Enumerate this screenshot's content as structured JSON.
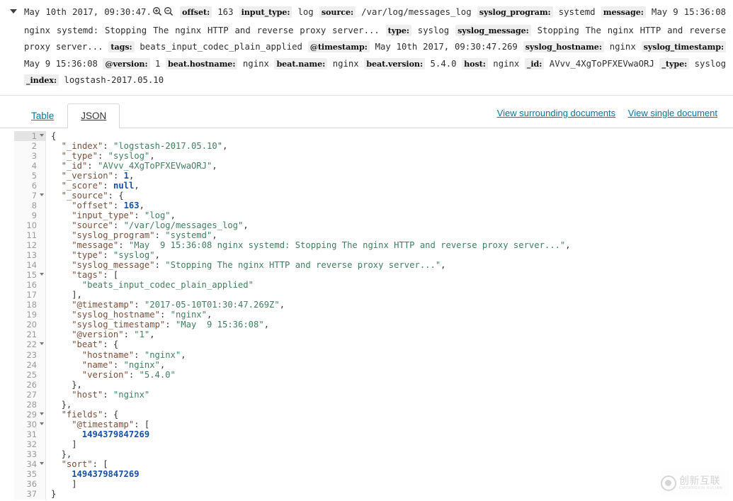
{
  "header": {
    "timestamp": "May 10th 2017, 09:30:47.",
    "zoom_in_icon": "magnify-plus-icon",
    "zoom_out_icon": "magnify-minus-icon",
    "expand_caret_icon": "caret-down-icon",
    "fields": [
      {
        "key": "offset",
        "value": "163"
      },
      {
        "key": "input_type",
        "value": "log"
      },
      {
        "key": "source",
        "value": "/var/log/messages_log"
      },
      {
        "key": "syslog_program",
        "value": "systemd"
      },
      {
        "key": "message",
        "value": "May 9 15:36:08 nginx systemd: Stopping The nginx HTTP and reverse proxy server..."
      },
      {
        "key": "type",
        "value": "syslog"
      },
      {
        "key": "syslog_message",
        "value": "Stopping The nginx HTTP and reverse proxy server..."
      },
      {
        "key": "tags",
        "value": "beats_input_codec_plain_applied"
      },
      {
        "key": "@timestamp",
        "value": "May 10th 2017, 09:30:47.269"
      },
      {
        "key": "syslog_hostname",
        "value": "nginx"
      },
      {
        "key": "syslog_timestamp",
        "value": "May 9 15:36:08"
      },
      {
        "key": "@version",
        "value": "1"
      },
      {
        "key": "beat.hostname",
        "value": "nginx"
      },
      {
        "key": "beat.name",
        "value": "nginx"
      },
      {
        "key": "beat.version",
        "value": "5.4.0"
      },
      {
        "key": "host",
        "value": "nginx"
      },
      {
        "key": "_id",
        "value": "AVvv_4XgToPFXEVwaORJ"
      },
      {
        "key": "_type",
        "value": "syslog"
      },
      {
        "key": "_index",
        "value": "logstash-2017.05.10"
      }
    ]
  },
  "tabs": [
    {
      "label": "Table",
      "active": false
    },
    {
      "label": "JSON",
      "active": true
    }
  ],
  "links": [
    {
      "label": "View surrounding documents"
    },
    {
      "label": "View single document"
    }
  ],
  "json_view": {
    "active_line": 1,
    "fold_lines": [
      1,
      7,
      15,
      22,
      29,
      30,
      34
    ],
    "lines": [
      {
        "n": 1,
        "indent": 0,
        "tokens": [
          {
            "t": "p",
            "v": "{"
          }
        ]
      },
      {
        "n": 2,
        "indent": 1,
        "tokens": [
          {
            "t": "k",
            "v": "\"_index\""
          },
          {
            "t": "p",
            "v": ": "
          },
          {
            "t": "s",
            "v": "\"logstash-2017.05.10\""
          },
          {
            "t": "p",
            "v": ","
          }
        ]
      },
      {
        "n": 3,
        "indent": 1,
        "tokens": [
          {
            "t": "k",
            "v": "\"_type\""
          },
          {
            "t": "p",
            "v": ": "
          },
          {
            "t": "s",
            "v": "\"syslog\""
          },
          {
            "t": "p",
            "v": ","
          }
        ]
      },
      {
        "n": 4,
        "indent": 1,
        "tokens": [
          {
            "t": "k",
            "v": "\"_id\""
          },
          {
            "t": "p",
            "v": ": "
          },
          {
            "t": "s",
            "v": "\"AVvv_4XgToPFXEVwaORJ\""
          },
          {
            "t": "p",
            "v": ","
          }
        ]
      },
      {
        "n": 5,
        "indent": 1,
        "tokens": [
          {
            "t": "k",
            "v": "\"_version\""
          },
          {
            "t": "p",
            "v": ": "
          },
          {
            "t": "n",
            "v": "1"
          },
          {
            "t": "p",
            "v": ","
          }
        ]
      },
      {
        "n": 6,
        "indent": 1,
        "tokens": [
          {
            "t": "k",
            "v": "\"_score\""
          },
          {
            "t": "p",
            "v": ": "
          },
          {
            "t": "nul",
            "v": "null"
          },
          {
            "t": "p",
            "v": ","
          }
        ]
      },
      {
        "n": 7,
        "indent": 1,
        "tokens": [
          {
            "t": "k",
            "v": "\"_source\""
          },
          {
            "t": "p",
            "v": ": {"
          }
        ]
      },
      {
        "n": 8,
        "indent": 2,
        "tokens": [
          {
            "t": "k",
            "v": "\"offset\""
          },
          {
            "t": "p",
            "v": ": "
          },
          {
            "t": "n",
            "v": "163"
          },
          {
            "t": "p",
            "v": ","
          }
        ]
      },
      {
        "n": 9,
        "indent": 2,
        "tokens": [
          {
            "t": "k",
            "v": "\"input_type\""
          },
          {
            "t": "p",
            "v": ": "
          },
          {
            "t": "s",
            "v": "\"log\""
          },
          {
            "t": "p",
            "v": ","
          }
        ]
      },
      {
        "n": 10,
        "indent": 2,
        "tokens": [
          {
            "t": "k",
            "v": "\"source\""
          },
          {
            "t": "p",
            "v": ": "
          },
          {
            "t": "s",
            "v": "\"/var/log/messages_log\""
          },
          {
            "t": "p",
            "v": ","
          }
        ]
      },
      {
        "n": 11,
        "indent": 2,
        "tokens": [
          {
            "t": "k",
            "v": "\"syslog_program\""
          },
          {
            "t": "p",
            "v": ": "
          },
          {
            "t": "s",
            "v": "\"systemd\""
          },
          {
            "t": "p",
            "v": ","
          }
        ]
      },
      {
        "n": 12,
        "indent": 2,
        "tokens": [
          {
            "t": "k",
            "v": "\"message\""
          },
          {
            "t": "p",
            "v": ": "
          },
          {
            "t": "s",
            "v": "\"May  9 15:36:08 nginx systemd: Stopping The nginx HTTP and reverse proxy server...\""
          },
          {
            "t": "p",
            "v": ","
          }
        ]
      },
      {
        "n": 13,
        "indent": 2,
        "tokens": [
          {
            "t": "k",
            "v": "\"type\""
          },
          {
            "t": "p",
            "v": ": "
          },
          {
            "t": "s",
            "v": "\"syslog\""
          },
          {
            "t": "p",
            "v": ","
          }
        ]
      },
      {
        "n": 14,
        "indent": 2,
        "tokens": [
          {
            "t": "k",
            "v": "\"syslog_message\""
          },
          {
            "t": "p",
            "v": ": "
          },
          {
            "t": "s",
            "v": "\"Stopping The nginx HTTP and reverse proxy server...\""
          },
          {
            "t": "p",
            "v": ","
          }
        ]
      },
      {
        "n": 15,
        "indent": 2,
        "tokens": [
          {
            "t": "k",
            "v": "\"tags\""
          },
          {
            "t": "p",
            "v": ": ["
          }
        ]
      },
      {
        "n": 16,
        "indent": 3,
        "tokens": [
          {
            "t": "s",
            "v": "\"beats_input_codec_plain_applied\""
          }
        ]
      },
      {
        "n": 17,
        "indent": 2,
        "tokens": [
          {
            "t": "p",
            "v": "],"
          }
        ]
      },
      {
        "n": 18,
        "indent": 2,
        "tokens": [
          {
            "t": "k",
            "v": "\"@timestamp\""
          },
          {
            "t": "p",
            "v": ": "
          },
          {
            "t": "s",
            "v": "\"2017-05-10T01:30:47.269Z\""
          },
          {
            "t": "p",
            "v": ","
          }
        ]
      },
      {
        "n": 19,
        "indent": 2,
        "tokens": [
          {
            "t": "k",
            "v": "\"syslog_hostname\""
          },
          {
            "t": "p",
            "v": ": "
          },
          {
            "t": "s",
            "v": "\"nginx\""
          },
          {
            "t": "p",
            "v": ","
          }
        ]
      },
      {
        "n": 20,
        "indent": 2,
        "tokens": [
          {
            "t": "k",
            "v": "\"syslog_timestamp\""
          },
          {
            "t": "p",
            "v": ": "
          },
          {
            "t": "s",
            "v": "\"May  9 15:36:08\""
          },
          {
            "t": "p",
            "v": ","
          }
        ]
      },
      {
        "n": 21,
        "indent": 2,
        "tokens": [
          {
            "t": "k",
            "v": "\"@version\""
          },
          {
            "t": "p",
            "v": ": "
          },
          {
            "t": "s",
            "v": "\"1\""
          },
          {
            "t": "p",
            "v": ","
          }
        ]
      },
      {
        "n": 22,
        "indent": 2,
        "tokens": [
          {
            "t": "k",
            "v": "\"beat\""
          },
          {
            "t": "p",
            "v": ": {"
          }
        ]
      },
      {
        "n": 23,
        "indent": 3,
        "tokens": [
          {
            "t": "k",
            "v": "\"hostname\""
          },
          {
            "t": "p",
            "v": ": "
          },
          {
            "t": "s",
            "v": "\"nginx\""
          },
          {
            "t": "p",
            "v": ","
          }
        ]
      },
      {
        "n": 24,
        "indent": 3,
        "tokens": [
          {
            "t": "k",
            "v": "\"name\""
          },
          {
            "t": "p",
            "v": ": "
          },
          {
            "t": "s",
            "v": "\"nginx\""
          },
          {
            "t": "p",
            "v": ","
          }
        ]
      },
      {
        "n": 25,
        "indent": 3,
        "tokens": [
          {
            "t": "k",
            "v": "\"version\""
          },
          {
            "t": "p",
            "v": ": "
          },
          {
            "t": "s",
            "v": "\"5.4.0\""
          }
        ]
      },
      {
        "n": 26,
        "indent": 2,
        "tokens": [
          {
            "t": "p",
            "v": "},"
          }
        ]
      },
      {
        "n": 27,
        "indent": 2,
        "tokens": [
          {
            "t": "k",
            "v": "\"host\""
          },
          {
            "t": "p",
            "v": ": "
          },
          {
            "t": "s",
            "v": "\"nginx\""
          }
        ]
      },
      {
        "n": 28,
        "indent": 1,
        "tokens": [
          {
            "t": "p",
            "v": "},"
          }
        ]
      },
      {
        "n": 29,
        "indent": 1,
        "tokens": [
          {
            "t": "k",
            "v": "\"fields\""
          },
          {
            "t": "p",
            "v": ": {"
          }
        ]
      },
      {
        "n": 30,
        "indent": 2,
        "tokens": [
          {
            "t": "k",
            "v": "\"@timestamp\""
          },
          {
            "t": "p",
            "v": ": ["
          }
        ]
      },
      {
        "n": 31,
        "indent": 3,
        "tokens": [
          {
            "t": "n",
            "v": "1494379847269"
          }
        ]
      },
      {
        "n": 32,
        "indent": 2,
        "tokens": [
          {
            "t": "p",
            "v": "]"
          }
        ]
      },
      {
        "n": 33,
        "indent": 1,
        "tokens": [
          {
            "t": "p",
            "v": "},"
          }
        ]
      },
      {
        "n": 34,
        "indent": 1,
        "tokens": [
          {
            "t": "k",
            "v": "\"sort\""
          },
          {
            "t": "p",
            "v": ": ["
          }
        ]
      },
      {
        "n": 35,
        "indent": 2,
        "tokens": [
          {
            "t": "n",
            "v": "1494379847269"
          }
        ]
      },
      {
        "n": 36,
        "indent": 2,
        "tokens": [
          {
            "t": "p",
            "v": "]"
          }
        ]
      },
      {
        "n": 37,
        "indent": 0,
        "tokens": [
          {
            "t": "p",
            "v": "}"
          }
        ]
      }
    ]
  },
  "watermark": {
    "cn": "创新互联",
    "en": "CHUANGXIN HULIAN",
    "logo_icon": "circle-x-logo-icon"
  },
  "colors": {
    "link": "#0079a5",
    "key": "#7b4f3a",
    "string": "#3f7f5f",
    "number": "#1750a5",
    "gutter_bg": "#fafafa"
  }
}
